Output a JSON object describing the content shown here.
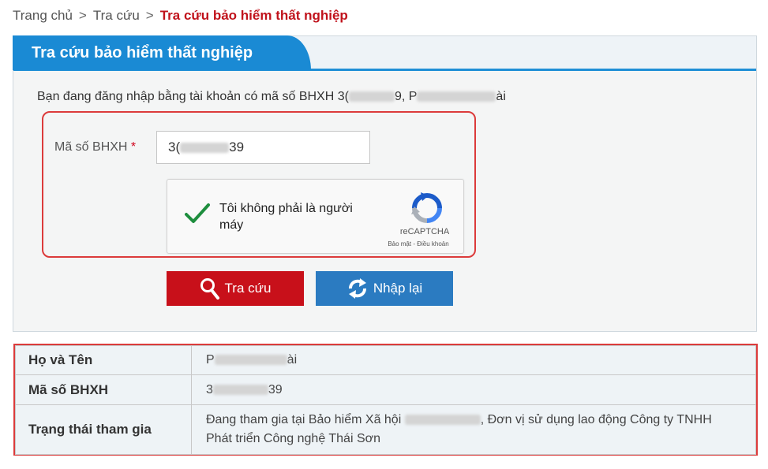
{
  "breadcrumb": {
    "home": "Trang chủ",
    "sep1": ">",
    "lookup": "Tra cứu",
    "sep2": ">",
    "current": "Tra cứu bảo hiểm thất nghiệp"
  },
  "panel": {
    "title": "Tra cứu bảo hiểm thất nghiệp"
  },
  "login_info": {
    "prefix": "Bạn đang đăng nhập bằng tài khoản có mã số BHXH",
    "code_start": "3(",
    "code_end": "9, P",
    "name_end": "ài"
  },
  "form": {
    "bhxh_label": "Mã số BHXH",
    "required_mark": "*",
    "bhxh_value_start": "3(",
    "bhxh_value_end": "39"
  },
  "captcha": {
    "label": "Tôi không phải là người máy",
    "brand": "reCAPTCHA",
    "terms": "Bảo mật - Điều khoản",
    "checked": true,
    "check_color": "#1e8e3e"
  },
  "buttons": {
    "search": "Tra cứu",
    "reset": "Nhập lại"
  },
  "result": {
    "rows": [
      {
        "key": "Họ và Tên",
        "value_start": "P",
        "value_end": "ài"
      },
      {
        "key": "Mã số BHXH",
        "value_start": "3",
        "value_end": "39"
      },
      {
        "key": "Trạng thái tham gia",
        "value_prefix": "Đang tham gia tại Bảo hiểm Xã hội",
        "value_suffix": ", Đơn vị sử dụng lao động Công ty TNHH Phát triển Công nghệ Thái Sơn"
      }
    ]
  },
  "colors": {
    "accent_blue": "#1a8ad4",
    "breadcrumb_current": "#c0121b",
    "search_button": "#c8101a",
    "reset_button": "#2b7bc1",
    "highlight_border": "#dc3b3b"
  }
}
